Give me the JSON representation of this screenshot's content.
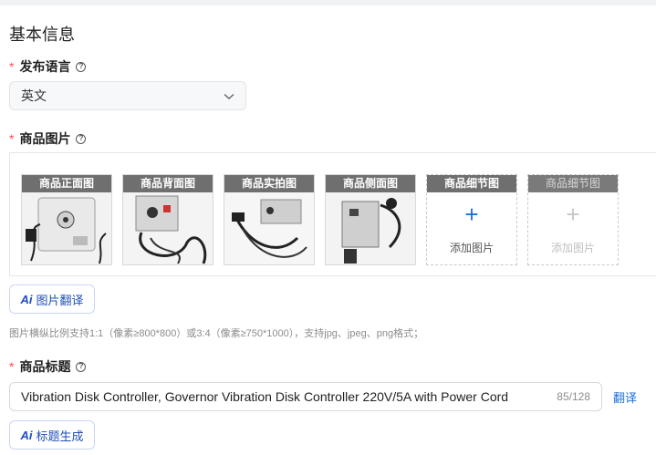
{
  "section": {
    "title": "基本信息"
  },
  "language": {
    "label": "发布语言",
    "required_mark": "*",
    "help": "?",
    "selected": "英文"
  },
  "images": {
    "label": "商品图片",
    "required_mark": "*",
    "help": "?",
    "slots": [
      {
        "caption": "商品正面图",
        "state": "filled"
      },
      {
        "caption": "商品背面图",
        "state": "filled"
      },
      {
        "caption": "商品实拍图",
        "state": "filled"
      },
      {
        "caption": "商品侧面图",
        "state": "filled"
      },
      {
        "caption": "商品细节图",
        "state": "empty",
        "add_label": "添加图片"
      },
      {
        "caption": "商品细节图",
        "state": "disabled",
        "add_label": "添加图片"
      }
    ],
    "translate_button": "图片翻译",
    "ai_badge": "Ai",
    "hint": "图片横纵比例支持1:1（像素≥800*800）或3:4（像素≥750*1000），支持jpg、jpeg、png格式；"
  },
  "title_field": {
    "label": "商品标题",
    "required_mark": "*",
    "help": "?",
    "value": "Vibration Disk Controller, Governor Vibration Disk Controller 220V/5A with Power Cord",
    "count": "85/128",
    "translate_link": "翻译",
    "generate_button": "标题生成",
    "ai_badge": "Ai"
  },
  "colors": {
    "required": "#ff4d4f",
    "link": "#1d6fd8",
    "caption_bg": "#6f6f6f"
  }
}
